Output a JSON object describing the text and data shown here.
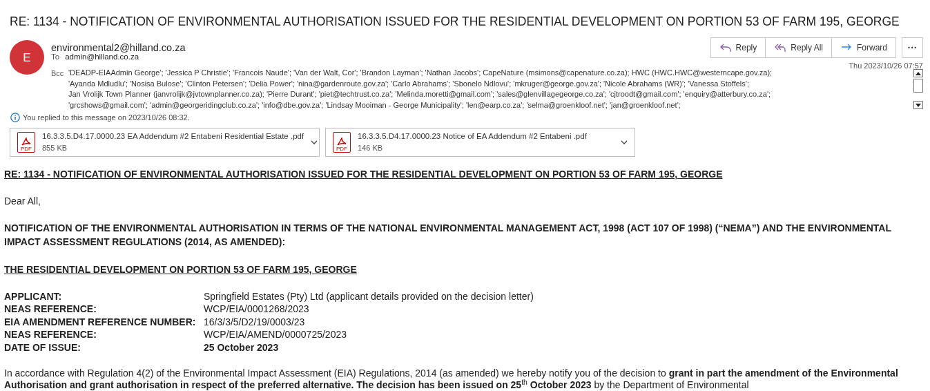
{
  "subject": "RE: 1134 - NOTIFICATION OF ENVIRONMENTAL AUTHORISATION ISSUED FOR THE RESIDENTIAL DEVELOPMENT ON PORTION 53 OF FARM 195, GEORGE",
  "sender": {
    "initial": "E",
    "address": "environmental2@hilland.co.za"
  },
  "to": {
    "label": "To",
    "value": "admin@hilland.co.za"
  },
  "bcc": {
    "label": "Bcc",
    "lines": [
      "'DEADP-EIAAdmin George'; 'Jessica P Christie'; 'Francois Naude'; 'Van der Walt, Cor'; 'Brandon Layman'; 'Nathan Jacobs'; CapeNature (msimons@capenature.co.za); HWC (HWC.HWC@westerncape.gov.za);",
      "'Ayanda Mdludlu'; 'Nosisa Bulose'; 'Clinton Petersen'; 'Delia Power'; 'nina@gardenroute.gov.za'; 'Carlo Abrahams'; 'Sbonelo Ndlovu'; 'mkruger@george.gov.za'; 'Nicole Abrahams (WR)'; 'Vanessa Stoffels';",
      "Jan Vrolijk Town Planner (janvrolijk@jvtownplanner.co.za); 'Pierre Durant'; 'piet@techtrust.co.za'; 'Melinda.moretti@gmail.com'; 'sales@glenvillagegeorge.co.za'; 'cjtroodt@gmail.com'; 'enquiry@atterbury.co.za';",
      "'grcshows@gmail.com'; 'admin@georgeridingclub.co.za'; 'info@dbe.gov.za'; 'Lindsay Mooiman - George Municipality'; 'len@earp.co.za'; 'selma@groenkloof.net'; 'jan@groenkloof.net';"
    ]
  },
  "actions": [
    {
      "kind": "reply",
      "label": "Reply"
    },
    {
      "kind": "reply_all",
      "label": "Reply All"
    },
    {
      "kind": "forward",
      "label": "Forward"
    },
    {
      "kind": "more",
      "label": "···"
    }
  ],
  "date": "Thu 2023/10/26 07:57",
  "info": "You replied to this message on 2023/10/26 08:32.",
  "attachments": [
    {
      "name": "16.3.3.5.D4.17.0000.23 EA Addendum #2 Entabeni Residential Estate .pdf",
      "size": "855 KB",
      "icon_label": "PDF"
    },
    {
      "name": "16.3.3.5.D4.17.0000.23 Notice of EA Addendum #2 Entabeni .pdf",
      "size": "146 KB",
      "icon_label": "PDF"
    }
  ],
  "body": {
    "title": "RE: 1134 - NOTIFICATION OF ENVIRONMENTAL AUTHORISATION ISSUED FOR THE RESIDENTIAL DEVELOPMENT ON PORTION 53 OF FARM 195, GEORGE",
    "greeting": "Dear All,",
    "heading": "NOTIFICATION OF THE ENVIRONMENTAL AUTHORISATION IN TERMS OF THE NATIONAL ENVIRONMENTAL MANAGEMENT ACT, 1998 (ACT 107 OF 1998) (“NEMA”) AND THE ENVIRONMENTAL IMPACT ASSESSMENT REGULATIONS (2014, AS AMENDED):",
    "subheading": "THE RESIDENTIAL DEVELOPMENT ON PORTION 53 OF FARM 195, GEORGE",
    "details": [
      {
        "label": "APPLICANT:",
        "value": "Springfield Estates (Pty) Ltd (applicant details provided on the decision letter)",
        "bold": false
      },
      {
        "label": "NEAS REFERENCE:",
        "value": "WCP/EIA/0001268/2023",
        "bold": false
      },
      {
        "label": "EIA AMENDMENT REFERENCE NUMBER:",
        "value": "16/3/3/5/D2/19/0003/23",
        "bold": false
      },
      {
        "label": "NEAS REFERENCE:",
        "value": "WCP/EIA/AMEND/0000725/2023",
        "bold": false
      },
      {
        "label": "DATE OF ISSUE:",
        "value": "25 October 2023",
        "bold": true
      }
    ],
    "paragraph": "In accordance with Regulation 4(2) of the Environmental Impact Assessment (EIA) Regulations, 2014 (as amended) we hereby notify you of the decision to **grant in part the amendment of the Environmental Authorisation and grant authorisation in respect of the preferred alternative. The decision has been issued on 25**$^{th}$ **October 2023** by the Department of Environmental"
  }
}
